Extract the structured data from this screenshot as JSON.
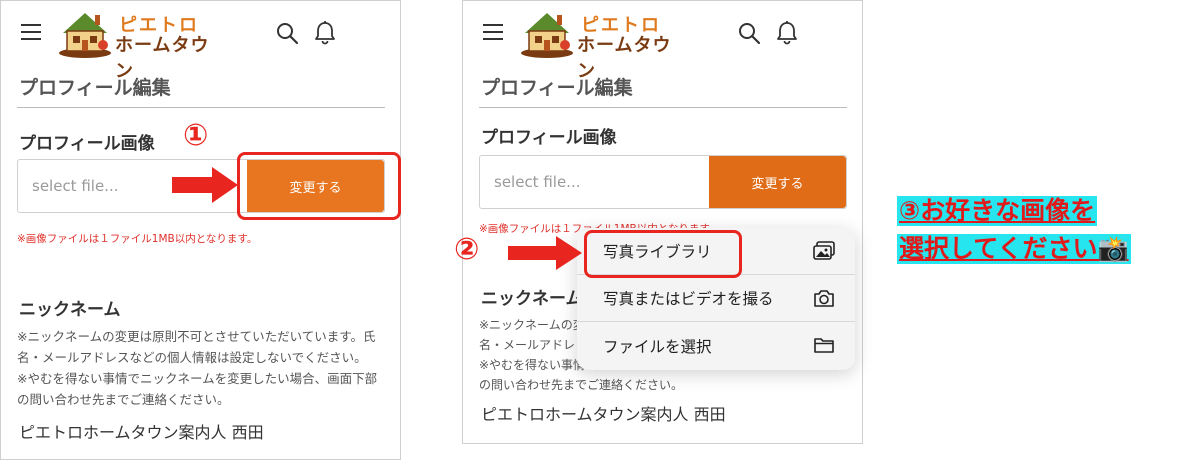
{
  "header": {
    "logo_line1": "ピエトロ",
    "logo_line2": "ホームタウン"
  },
  "page": {
    "title": "プロフィール編集",
    "profile_image_label": "プロフィール画像",
    "file_placeholder": "select file...",
    "change_button": "変更する",
    "file_note": "※画像ファイルは１ファイル1MB以内となります。",
    "nickname_label": "ニックネーム",
    "nickname_desc_1": "※ニックネームの変更は原則不可とさせていただいています。氏",
    "nickname_desc_2": "名・メールアドレスなどの個人情報は設定しないでください。",
    "nickname_desc_3": "※やむを得ない事情でニックネームを変更したい場合、画面下部",
    "nickname_desc_4": "の問い合わせ先までご連絡ください。",
    "guide_name": "ピエトロホームタウン案内人 西田"
  },
  "phone2_partial": {
    "nickname_label": "ニックネーム",
    "desc_1": "※ニックネームの変",
    "desc_2": "名・メールアドレ",
    "desc_3": "※やむを得ない事情",
    "desc_4": "の問い合わせ先までご連絡ください。"
  },
  "popup_menu": {
    "items": [
      {
        "label": "写真ライブラリ",
        "icon": "photo-library-icon"
      },
      {
        "label": "写真またはビデオを撮る",
        "icon": "camera-icon"
      },
      {
        "label": "ファイルを選択",
        "icon": "folder-icon"
      }
    ]
  },
  "steps": {
    "step1": "①",
    "step2": "②",
    "instruction_line1": "③お好きな画像を",
    "instruction_line2": "選択してください📸"
  },
  "colors": {
    "accent_orange": "#e8751f",
    "highlight_red": "#e8251f",
    "instruction_bg": "#26e5ee"
  }
}
